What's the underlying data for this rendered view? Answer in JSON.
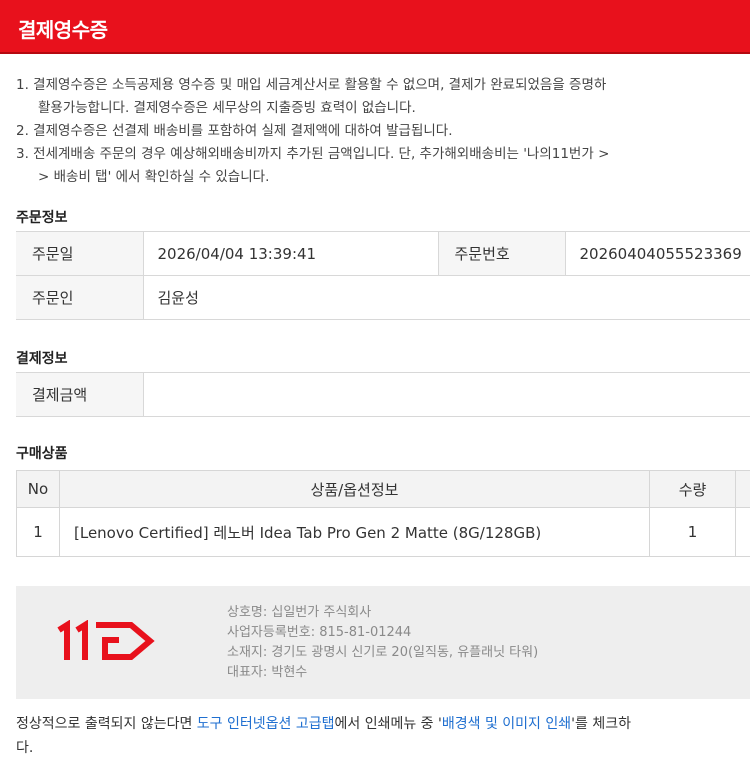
{
  "header": {
    "title": "결제영수증"
  },
  "notices": [
    "1. 결제영수증은 소득공제용 영수증 및 매입 세금계산서로 활용할 수 없으며, 결제가 완료되었음을 증명하",
    "활용가능합니다. 결제영수증은 세무상의 지출증빙 효력이 없습니다.",
    "2. 결제영수증은 선결제 배송비를 포함하여 실제 결제액에 대하여 발급됩니다.",
    "3. 전세계배송 주문의 경우 예상해외배송비까지 추가된 금액입니다. 단, 추가해외배송비는 '나의11번가 >",
    "> 배송비 탭' 에서 확인하실 수 있습니다."
  ],
  "order_info": {
    "title": "주문정보",
    "order_date_label": "주문일",
    "order_date": "2026/04/04 13:39:41",
    "order_no_label": "주문번호",
    "order_no": "20260404055523369",
    "orderer_label": "주문인",
    "orderer": "김윤성"
  },
  "payment_info": {
    "title": "결제정보",
    "amount_label": "결제금액",
    "amount": ""
  },
  "products": {
    "title": "구매상품",
    "headers": {
      "no": "No",
      "name": "상품/옵션정보",
      "qty": "수량"
    },
    "rows": [
      {
        "no": "1",
        "name": "[Lenovo Certified] 레노버 Idea Tab Pro Gen 2 Matte (8G/128GB)",
        "qty": "1"
      }
    ]
  },
  "company": {
    "logo_colors": {
      "primary": "#e8111c"
    },
    "name": "상호명: 십일번가 주식회사",
    "reg_no": "사업자등록번호: 815-81-01244",
    "address": "소재지: 경기도 광명시 신기로 20(일직동, 유플래닛 타워)",
    "ceo": "대표자: 박현수"
  },
  "bottom_note": {
    "prefix": "정상적으로 출력되지 않는다면 ",
    "link1": "도구 인터넷옵션 고급탭",
    "middle": "에서 인쇄메뉴 중 '",
    "link2": "배경색 및 이미지 인쇄",
    "suffix": "'를 체크하",
    "line2": "다."
  },
  "colors": {
    "brand_red": "#e8111c",
    "link_blue": "#1f6fd0"
  }
}
